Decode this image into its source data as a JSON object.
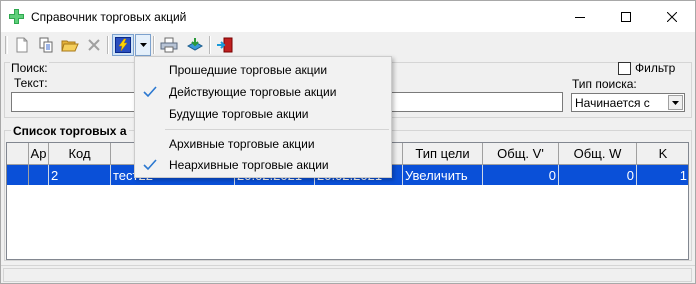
{
  "window": {
    "title": "Справочник торговых акций",
    "buttons": [
      "minimize",
      "maximize",
      "close"
    ]
  },
  "toolbar": {
    "buttons": [
      {
        "name": "new-document-icon"
      },
      {
        "name": "copy-document-icon"
      },
      {
        "name": "open-folder-icon"
      },
      {
        "name": "delete-icon"
      },
      {
        "name": "lightning-filter-icon"
      },
      {
        "name": "print-icon"
      },
      {
        "name": "export-icon"
      },
      {
        "name": "exit-door-icon"
      }
    ]
  },
  "search": {
    "group_label": "Поиск:",
    "text_label": "Текст:",
    "text_value": "",
    "filter_label": "Фильтр",
    "filter_checked": false,
    "type_label": "Тип поиска:",
    "type_value": "Начинается с"
  },
  "list": {
    "group_label": "Список торговых а",
    "columns": [
      "Ар",
      "Код",
      "На",
      "",
      "",
      "Тип цели",
      "Общ. V'",
      "Общ. W",
      "K"
    ],
    "rows": [
      {
        "ar": "",
        "code": "2",
        "name": "тест22",
        "date_from": "20.02.2021",
        "date_to": "20.02.2021",
        "target_type": "Увеличить",
        "total_v": "0",
        "total_w": "0",
        "k": "1"
      }
    ]
  },
  "menu": {
    "items": [
      {
        "label": "Прошедшие торговые акции",
        "checked": false
      },
      {
        "label": "Действующие торговые акции",
        "checked": true
      },
      {
        "label": "Будущие торговые акции",
        "checked": false
      },
      {
        "label": "Архивные торговые акции",
        "checked": false
      },
      {
        "label": "Неархивные торговые акции",
        "checked": true
      }
    ]
  },
  "colors": {
    "selection": "#0a50d8",
    "check": "#2b78d0"
  }
}
